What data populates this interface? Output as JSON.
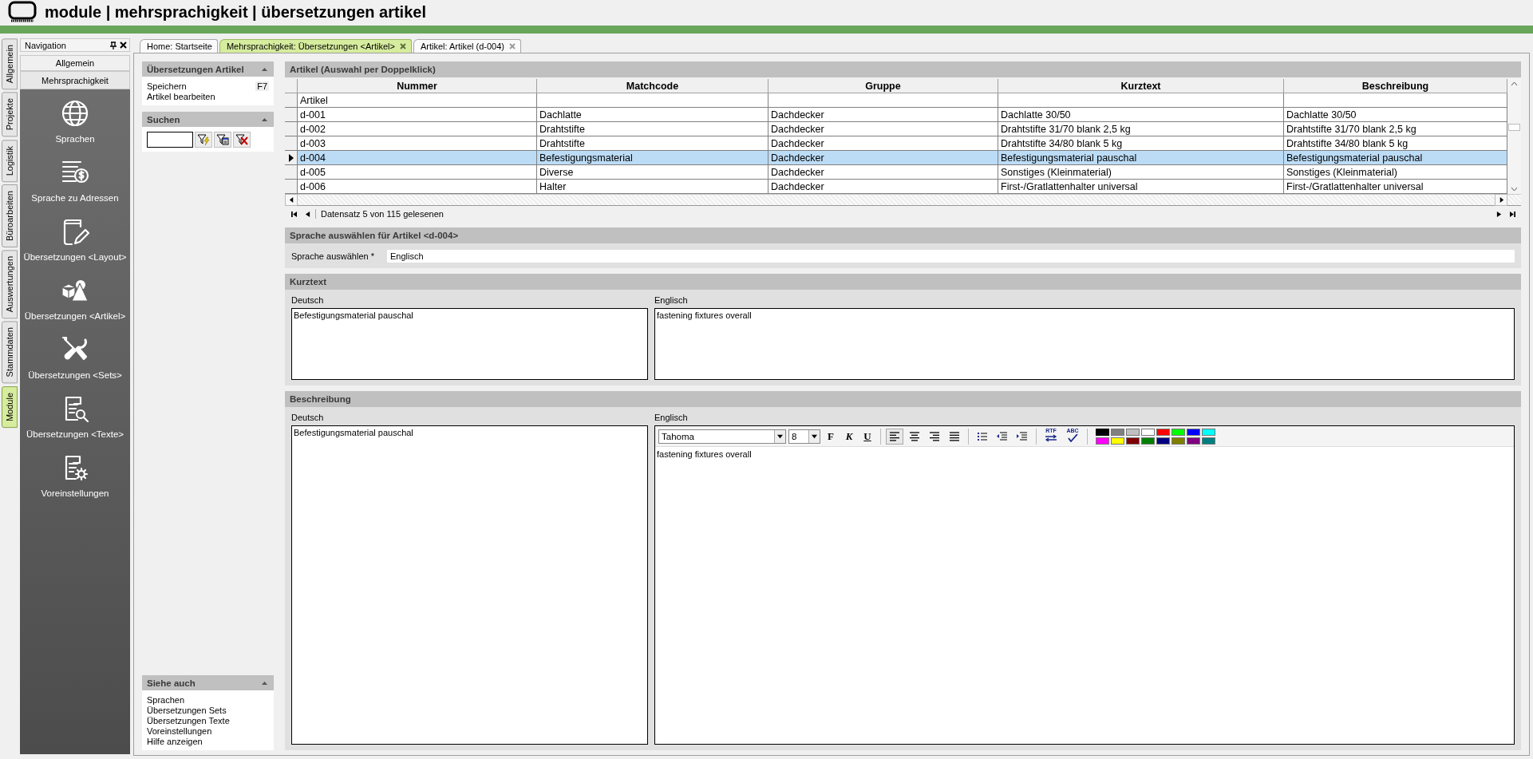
{
  "header": {
    "title": "module | mehrsprachigkeit | übersetzungen artikel"
  },
  "side_tabs": [
    {
      "label": "Allgemein",
      "selected": false
    },
    {
      "label": "Projekte",
      "selected": false
    },
    {
      "label": "Logistik",
      "selected": false
    },
    {
      "label": "Büroarbeiten",
      "selected": false
    },
    {
      "label": "Auswertungen",
      "selected": false
    },
    {
      "label": "Stammdaten",
      "selected": false
    },
    {
      "label": "Module",
      "selected": true
    }
  ],
  "navigation": {
    "title": "Navigation",
    "groups": [
      {
        "label": "Allgemein",
        "selected": false
      },
      {
        "label": "Mehrsprachigkeit",
        "selected": true
      }
    ],
    "items": [
      {
        "label": "Sprachen"
      },
      {
        "label": "Sprache zu Adressen"
      },
      {
        "label": "Übersetzungen <Layout>"
      },
      {
        "label": "Übersetzungen <Artikel>"
      },
      {
        "label": "Übersetzungen <Sets>"
      },
      {
        "label": "Übersetzungen <Texte>"
      },
      {
        "label": "Voreinstellungen"
      }
    ]
  },
  "doc_tabs": [
    {
      "label": "Home: Startseite",
      "selected": false,
      "closable": false
    },
    {
      "label": "Mehrsprachigkeit: Übersetzungen <Artikel>",
      "selected": true,
      "closable": true
    },
    {
      "label": "Artikel: Artikel (d-004)",
      "selected": false,
      "closable": true
    }
  ],
  "task_pane": {
    "actions": {
      "title": "Übersetzungen Artikel",
      "items": [
        {
          "label": "Speichern",
          "shortcut": "F7"
        },
        {
          "label": "Artikel bearbeiten"
        }
      ]
    },
    "search": {
      "title": "Suchen"
    },
    "see_also": {
      "title": "Siehe auch",
      "items": [
        {
          "label": "Sprachen"
        },
        {
          "label": "Übersetzungen Sets"
        },
        {
          "label": "Übersetzungen Texte"
        },
        {
          "label": "Voreinstellungen"
        },
        {
          "label": "Hilfe anzeigen"
        }
      ]
    }
  },
  "grid": {
    "title": "Artikel (Auswahl per Doppelklick)",
    "columns": [
      "Nummer",
      "Matchcode",
      "Gruppe",
      "Kurztext",
      "Beschreibung"
    ],
    "filter": "Artikel",
    "rows": [
      {
        "cells": [
          "d-001",
          "Dachlatte",
          "Dachdecker",
          "Dachlatte 30/50",
          "Dachlatte 30/50"
        ],
        "selected": false
      },
      {
        "cells": [
          "d-002",
          "Drahtstifte",
          "Dachdecker",
          "Drahtstifte 31/70 blank 2,5 kg",
          "Drahtstifte 31/70 blank 2,5 kg"
        ],
        "selected": false
      },
      {
        "cells": [
          "d-003",
          "Drahtstifte",
          "Dachdecker",
          "Drahtstifte 34/80 blank 5 kg",
          "Drahtstifte 34/80 blank 5 kg"
        ],
        "selected": false
      },
      {
        "cells": [
          "d-004",
          "Befestigungsmaterial",
          "Dachdecker",
          "Befestigungsmaterial pauschal",
          "Befestigungsmaterial pauschal"
        ],
        "selected": true
      },
      {
        "cells": [
          "d-005",
          "Diverse",
          "Dachdecker",
          "Sonstiges (Kleinmaterial)",
          "Sonstiges (Kleinmaterial)"
        ],
        "selected": false
      },
      {
        "cells": [
          "d-006",
          "Halter",
          "Dachdecker",
          "First-/Gratlattenhalter universal",
          "First-/Gratlattenhalter universal"
        ],
        "selected": false
      }
    ],
    "status": "Datensatz 5 von 115 gelesenen"
  },
  "language": {
    "title": "Sprache auswählen für Artikel <d-004>",
    "label": "Sprache auswählen *",
    "value": "Englisch"
  },
  "kurztext": {
    "title": "Kurztext",
    "source_label": "Deutsch",
    "source_text": "Befestigungsmaterial pauschal",
    "target_label": "Englisch",
    "target_text": "fastening fixtures overall"
  },
  "beschreibung": {
    "title": "Beschreibung",
    "source_label": "Deutsch",
    "source_text": "Befestigungsmaterial pauschal",
    "target_label": "Englisch",
    "target_text": "fastening fixtures overall",
    "toolbar": {
      "font": "Tahoma",
      "size": "8",
      "format_buttons": [
        "F",
        "K",
        "U"
      ],
      "rtf_label": "RTF",
      "spell_label": "ABC",
      "palette": [
        {
          "color": "#000000"
        },
        {
          "color": "#808080"
        },
        {
          "color": "#c0c0c0"
        },
        {
          "color": "#ffffff"
        },
        {
          "color": "#ff0000"
        },
        {
          "color": "#00ff00"
        },
        {
          "color": "#0000ff"
        },
        {
          "color": "#00ffff"
        },
        {
          "color": "#ff00ff"
        },
        {
          "color": "#ffff00"
        },
        {
          "color": "#800000"
        },
        {
          "color": "#008000"
        },
        {
          "color": "#000080"
        },
        {
          "color": "#808000"
        },
        {
          "color": "#800080"
        },
        {
          "color": "#008080"
        }
      ]
    }
  }
}
